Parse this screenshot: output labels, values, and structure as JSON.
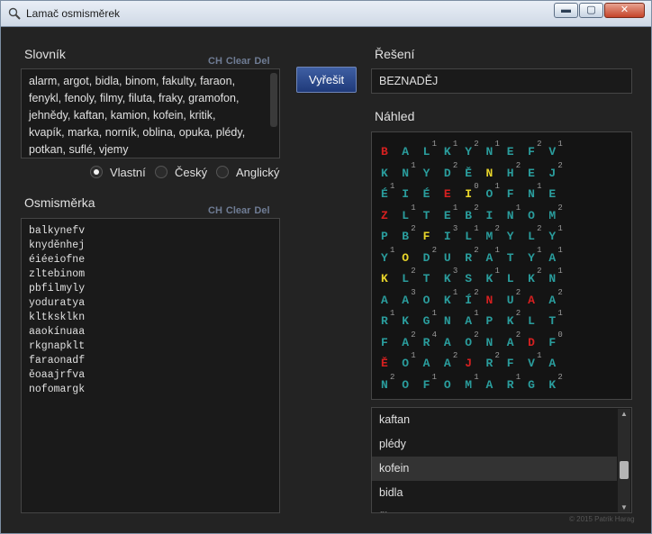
{
  "window": {
    "title": "Lamač osmisměrek",
    "min": "▬",
    "max": "▢",
    "close": "✕"
  },
  "dictionary": {
    "label": "Slovník",
    "actions": [
      "CH",
      "Clear",
      "Del"
    ],
    "lines": [
      "alarm, argot, bidla, binom, fakulty, faraon,",
      "fenykl, fenoly, filmy, filuta, fraky, gramofon,",
      "jehnědy, kaftan, kamion, kofein, kritik,",
      "kvapík, marka, norník, oblina, opuka, plédy,",
      "potkan, suflé, vjemy"
    ]
  },
  "language": {
    "options": [
      "Vlastní",
      "Český",
      "Anglický"
    ],
    "selected": 0
  },
  "grid_input": {
    "label": "Osmisměrka",
    "actions": [
      "CH",
      "Clear",
      "Del"
    ],
    "rows": [
      "balkynefv",
      "knyděnhej",
      "éiéeiofne",
      "zltebinom",
      "pbfilmyly",
      "yoduratya",
      "kltksklkn",
      "aaokínuaa",
      "rkgnapklt",
      "faraonadf",
      "ěoaajrfva",
      "nofomargk"
    ]
  },
  "solve_button": "Vyřešit",
  "solution": {
    "label": "Řešení",
    "value": "BEZNADĚJ"
  },
  "preview": {
    "label": "Náhled",
    "colors": {
      "t": "#2a9d9d",
      "r": "#d62020",
      "y": "#e8d52a"
    },
    "rows": [
      [
        [
          "B",
          "",
          "r"
        ],
        [
          "A",
          "",
          "t"
        ],
        [
          "L",
          "1",
          "t"
        ],
        [
          "K",
          "1",
          "t"
        ],
        [
          "Y",
          "2",
          "t"
        ],
        [
          "N",
          "1",
          "t"
        ],
        [
          "E",
          "",
          "t"
        ],
        [
          "F",
          "2",
          "t"
        ],
        [
          "V",
          "1",
          "t"
        ]
      ],
      [
        [
          "K",
          "",
          "t"
        ],
        [
          "N",
          "1",
          "t"
        ],
        [
          "Y",
          "",
          "t"
        ],
        [
          "D",
          "2",
          "t"
        ],
        [
          "Ě",
          "",
          "t"
        ],
        [
          "N",
          "",
          "y"
        ],
        [
          "H",
          "2",
          "t"
        ],
        [
          "E",
          "",
          "t"
        ],
        [
          "J",
          "2",
          "t"
        ]
      ],
      [
        [
          "É",
          "1",
          "t"
        ],
        [
          "I",
          "",
          "t"
        ],
        [
          "É",
          "",
          "t"
        ],
        [
          "E",
          "",
          "r"
        ],
        [
          "I",
          "0",
          "y"
        ],
        [
          "O",
          "1",
          "t"
        ],
        [
          "F",
          "",
          "t"
        ],
        [
          "N",
          "1",
          "t"
        ],
        [
          "E",
          "",
          "t"
        ]
      ],
      [
        [
          "Z",
          "",
          "r"
        ],
        [
          "L",
          "1",
          "t"
        ],
        [
          "T",
          "",
          "t"
        ],
        [
          "E",
          "1",
          "t"
        ],
        [
          "B",
          "2",
          "t"
        ],
        [
          "I",
          "",
          "t"
        ],
        [
          "N",
          "1",
          "t"
        ],
        [
          "O",
          "",
          "t"
        ],
        [
          "M",
          "2",
          "t"
        ]
      ],
      [
        [
          "P",
          "",
          "t"
        ],
        [
          "B",
          "2",
          "t"
        ],
        [
          "F",
          "",
          "y"
        ],
        [
          "I",
          "3",
          "t"
        ],
        [
          "L",
          "1",
          "t"
        ],
        [
          "M",
          "2",
          "t"
        ],
        [
          "Y",
          "",
          "t"
        ],
        [
          "L",
          "2",
          "t"
        ],
        [
          "Y",
          "1",
          "t"
        ]
      ],
      [
        [
          "Y",
          "1",
          "t"
        ],
        [
          "O",
          "",
          "y"
        ],
        [
          "D",
          "2",
          "t"
        ],
        [
          "U",
          "",
          "t"
        ],
        [
          "R",
          "2",
          "t"
        ],
        [
          "A",
          "1",
          "t"
        ],
        [
          "T",
          "",
          "t"
        ],
        [
          "Y",
          "1",
          "t"
        ],
        [
          "A",
          "1",
          "t"
        ]
      ],
      [
        [
          "K",
          "",
          "y"
        ],
        [
          "L",
          "2",
          "t"
        ],
        [
          "T",
          "",
          "t"
        ],
        [
          "K",
          "3",
          "t"
        ],
        [
          "S",
          "",
          "t"
        ],
        [
          "K",
          "1",
          "t"
        ],
        [
          "L",
          "",
          "t"
        ],
        [
          "K",
          "2",
          "t"
        ],
        [
          "N",
          "1",
          "t"
        ]
      ],
      [
        [
          "A",
          "",
          "t"
        ],
        [
          "A",
          "3",
          "t"
        ],
        [
          "O",
          "",
          "t"
        ],
        [
          "K",
          "1",
          "t"
        ],
        [
          "Í",
          "2",
          "t"
        ],
        [
          "N",
          "",
          "r"
        ],
        [
          "U",
          "2",
          "t"
        ],
        [
          "A",
          "",
          "r"
        ],
        [
          "A",
          "2",
          "t"
        ]
      ],
      [
        [
          "R",
          "1",
          "t"
        ],
        [
          "K",
          "",
          "t"
        ],
        [
          "G",
          "1",
          "t"
        ],
        [
          "N",
          "",
          "t"
        ],
        [
          "A",
          "1",
          "t"
        ],
        [
          "P",
          "",
          "t"
        ],
        [
          "K",
          "2",
          "t"
        ],
        [
          "L",
          "",
          "t"
        ],
        [
          "T",
          "1",
          "t"
        ]
      ],
      [
        [
          "F",
          "",
          "t"
        ],
        [
          "A",
          "2",
          "t"
        ],
        [
          "R",
          "4",
          "t"
        ],
        [
          "A",
          "",
          "t"
        ],
        [
          "O",
          "2",
          "t"
        ],
        [
          "N",
          "",
          "t"
        ],
        [
          "A",
          "2",
          "t"
        ],
        [
          "D",
          "",
          "r"
        ],
        [
          "F",
          "0",
          "t"
        ]
      ],
      [
        [
          "Ě",
          "",
          "r"
        ],
        [
          "O",
          "1",
          "t"
        ],
        [
          "A",
          "",
          "t"
        ],
        [
          "A",
          "2",
          "t"
        ],
        [
          "J",
          "",
          "r"
        ],
        [
          "R",
          "2",
          "t"
        ],
        [
          "F",
          "",
          "t"
        ],
        [
          "V",
          "1",
          "t"
        ],
        [
          "A",
          "",
          "t"
        ]
      ],
      [
        [
          "N",
          "2",
          "t"
        ],
        [
          "O",
          "",
          "t"
        ],
        [
          "F",
          "1",
          "t"
        ],
        [
          "O",
          "",
          "t"
        ],
        [
          "M",
          "1",
          "t"
        ],
        [
          "A",
          "",
          "t"
        ],
        [
          "R",
          "1",
          "t"
        ],
        [
          "G",
          "",
          "t"
        ],
        [
          "K",
          "2",
          "t"
        ]
      ]
    ]
  },
  "words_list": {
    "items": [
      "kaftan",
      "plédy",
      "kofein",
      "bidla",
      "filuta"
    ],
    "selected": 2
  },
  "copyright": "© 2015 Patrik Harag"
}
